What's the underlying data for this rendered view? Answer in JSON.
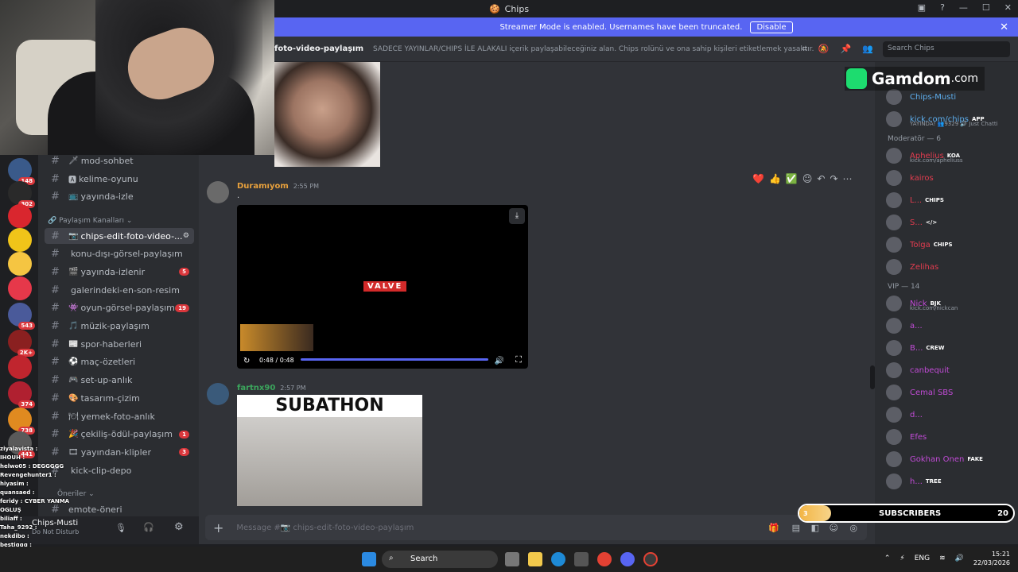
{
  "window": {
    "title": "Chips"
  },
  "banner": {
    "text": "Streamer Mode is enabled. Usernames have been truncated.",
    "button": "Disable"
  },
  "channel_header": {
    "name": "foto-video-paylaşım",
    "topic": "SADECE YAYINLAR/CHIPS İLE ALAKALI içerik paylaşabileceğiniz alan. Chips rolünü ve ona sahip kişileri etiketlemek yasaktır.",
    "search_placeholder": "Search Chips"
  },
  "server_badges": [
    "148",
    "302",
    "543",
    "2K+",
    "374",
    "738",
    "441"
  ],
  "channels": {
    "top": [
      {
        "icon": "🗡",
        "label": "mod-sohbet"
      },
      {
        "icon": "🅰",
        "label": "kelime-oyunu"
      },
      {
        "icon": "📺",
        "label": "yayında-izle"
      }
    ],
    "category_label": "Paylaşım Kanalları",
    "list": [
      {
        "icon": "📷",
        "label": "chips-edit-foto-video-...",
        "active": true,
        "count": ""
      },
      {
        "icon": "",
        "label": "konu-dışı-görsel-paylaşım",
        "count": ""
      },
      {
        "icon": "🎬",
        "label": "yayında-izlenir",
        "count": "5"
      },
      {
        "icon": "",
        "label": "galerindeki-en-son-resim",
        "count": ""
      },
      {
        "icon": "👾",
        "label": "oyun-görsel-paylaşım",
        "count": "19"
      },
      {
        "icon": "🎵",
        "label": "müzik-paylaşım",
        "count": ""
      },
      {
        "icon": "📰",
        "label": "spor-haberleri",
        "count": ""
      },
      {
        "icon": "⚽",
        "label": "maç-özetleri",
        "count": ""
      },
      {
        "icon": "🎮",
        "label": "set-up-anlık",
        "count": ""
      },
      {
        "icon": "🎨",
        "label": "tasarım-çizim",
        "count": ""
      },
      {
        "icon": "🍽",
        "label": "yemek-foto-anlık",
        "count": ""
      },
      {
        "icon": "🎉",
        "label": "çekiliş-ödül-paylaşım",
        "count": "1"
      },
      {
        "icon": "🎞",
        "label": "yayından-klipler",
        "count": "3"
      },
      {
        "icon": "",
        "label": "kick-clip-depo",
        "count": ""
      }
    ],
    "oneriler": "Öneriler",
    "last": "emote-öneri"
  },
  "user_panel": {
    "name": "Chips-Musti",
    "status": "Do Not Disturb"
  },
  "stream_chat": [
    "ziyalavista : ",
    "IHOUH : ",
    "helwo05 : DEGGGGG",
    "Revengehunter1 : ",
    "hiyasim : ",
    "quansaed : ",
    "feridy : CYBER YANMA OGLUŞ",
    "biliaff : ",
    "Taha_9292 : ",
    "nekdibo : ",
    "bestiggg : "
  ],
  "messages": [
    {
      "author": "Duramıyom",
      "time": "2:55 PM",
      "text": ".",
      "color": "#e8a13c"
    },
    {
      "author": "fartnx90",
      "time": "2:57 PM",
      "text": "",
      "color": "#3ba55c"
    }
  ],
  "video": {
    "watermark": "VALVE",
    "time": "0:48 / 0:48",
    "progress": 1.0
  },
  "embed_text": "SUBATHON",
  "reactions": [
    "❤️",
    "👍",
    "✅"
  ],
  "composer": {
    "placeholder": "Message #📷 chips-edit-foto-video-paylaşım"
  },
  "gamdom": {
    "brand": "Gamdom",
    "tld": ".com"
  },
  "members": {
    "top": [
      {
        "name": "Chips-Musti",
        "color": "#5dadec",
        "sub": ""
      },
      {
        "name": "kick.com/chips",
        "color": "#5dadec",
        "tag": "APP",
        "sub": "YAYINDA! 👥9329 🔊 Just Chatti"
      }
    ],
    "mod_section": "Moderatör — 6",
    "mods": [
      {
        "name": "Aphelius",
        "color": "#e23c4f",
        "tag": "KOA",
        "sub": "kick.com/apheliuss"
      },
      {
        "name": "kairos",
        "color": "#e23c4f",
        "tag": "",
        "sub": ""
      },
      {
        "name": "L...",
        "color": "#e23c4f",
        "tag": "CHIPS",
        "sub": ""
      },
      {
        "name": "S...",
        "color": "#e23c4f",
        "tag": "</>",
        "sub": ""
      },
      {
        "name": "Tolga",
        "color": "#e23c4f",
        "tag": "CHIPS",
        "sub": ""
      },
      {
        "name": "Zelihas",
        "color": "#e23c4f",
        "tag": "",
        "sub": ""
      }
    ],
    "vip_section": "VIP — 14",
    "vips": [
      {
        "name": "Nick",
        "color": "#c14bd6",
        "tag": "BJK",
        "sub": "kick.com/nickcan"
      },
      {
        "name": "a...",
        "color": "#c14bd6",
        "tag": "",
        "sub": ""
      },
      {
        "name": "B...",
        "color": "#c14bd6",
        "tag": "CREW",
        "sub": ""
      },
      {
        "name": "canbequit",
        "color": "#c14bd6",
        "tag": "",
        "sub": ""
      },
      {
        "name": "Cemal SBS",
        "color": "#c14bd6",
        "tag": "",
        "sub": ""
      },
      {
        "name": "d...",
        "color": "#c14bd6",
        "tag": "",
        "sub": ""
      },
      {
        "name": "Efes",
        "color": "#c14bd6",
        "tag": "",
        "sub": ""
      },
      {
        "name": "Gokhan Onen",
        "color": "#c14bd6",
        "tag": "FAKE",
        "sub": ""
      },
      {
        "name": "h...",
        "color": "#c14bd6",
        "tag": "TREE",
        "sub": ""
      }
    ]
  },
  "subs_bar": {
    "current": "3",
    "label": "SUBSCRIBERS",
    "goal": "20",
    "fraction": 0.15
  },
  "taskbar": {
    "search": "Search",
    "lang": "ENG",
    "time": "15:21",
    "date": "22/03/2026"
  }
}
